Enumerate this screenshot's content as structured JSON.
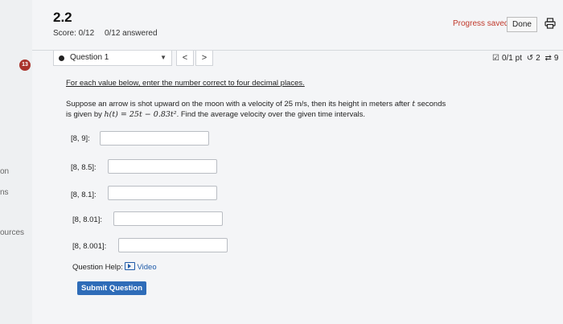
{
  "sidebar": {
    "fragments": [
      "on",
      "ns",
      "ources"
    ]
  },
  "header": {
    "title": "2.2",
    "score_label": "Score: 0/12",
    "answered": "0/12 answered",
    "progress_saved": "Progress saved",
    "done_label": "Done"
  },
  "question_nav": {
    "number_badge": "13",
    "selected": "Question 1",
    "prev": "<",
    "next": ">",
    "points": "0/1 pt",
    "retries": "2",
    "submissions": "9"
  },
  "problem": {
    "instructions": "For each value below, enter the number correct to four decimal places.",
    "text_1": "Suppose an arrow is shot upward on the moon with a velocity of 25 m/s, then its height in meters after",
    "text_var_t": "t",
    "text_2": "seconds is given by",
    "formula": "h(t) = 25t − 0.83t²",
    "text_3": ". Find the average velocity over the given time intervals."
  },
  "answers": [
    {
      "label": "[8, 9]:",
      "value": ""
    },
    {
      "label": "[8, 8.5]:",
      "value": ""
    },
    {
      "label": "[8, 8.1]:",
      "value": ""
    },
    {
      "label": "[8, 8.01]:",
      "value": ""
    },
    {
      "label": "[8, 8.001]:",
      "value": ""
    }
  ],
  "help": {
    "label": "Question Help:",
    "video": "Video"
  },
  "submit_label": "Submit Question"
}
